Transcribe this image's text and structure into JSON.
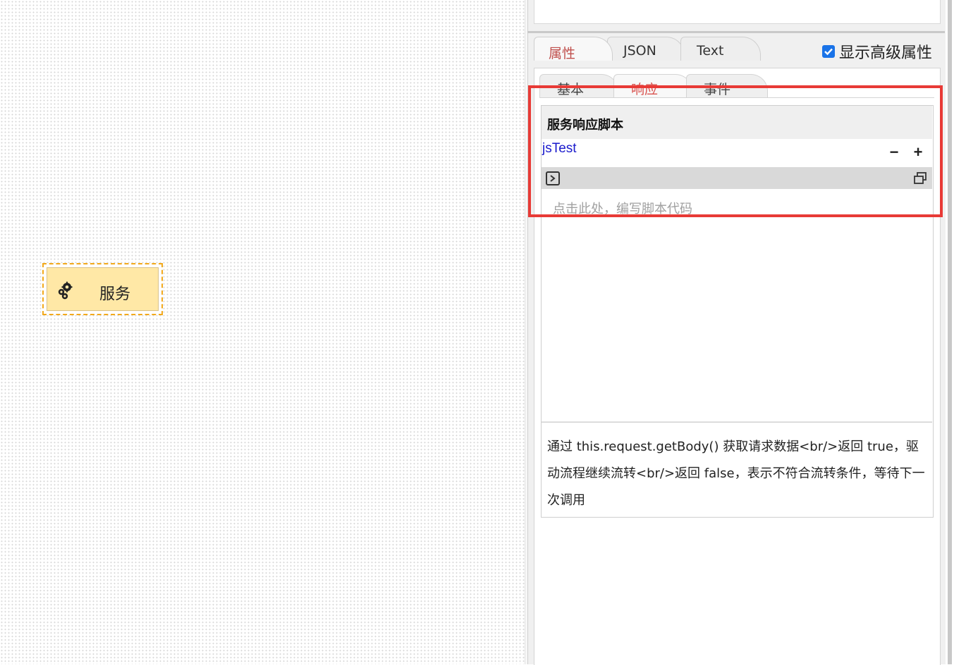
{
  "canvas": {
    "node": {
      "label": "服务",
      "icon": "gears-icon"
    }
  },
  "panel": {
    "tabs": [
      {
        "label": "属性",
        "active": true
      },
      {
        "label": "JSON",
        "active": false
      },
      {
        "label": "Text",
        "active": false
      }
    ],
    "show_advanced": {
      "label": "显示高级属性",
      "checked": true
    },
    "subtabs": [
      {
        "label": "基本",
        "active": false
      },
      {
        "label": "响应",
        "active": true
      },
      {
        "label": "事件",
        "active": false
      }
    ],
    "script": {
      "title": "服务响应脚本",
      "name": "jsTest",
      "remove_label": "−",
      "add_label": "+",
      "placeholder": "点击此处，编写脚本代码",
      "description": "通过 this.request.getBody() 获取请求数据<br/>返回 true，驱动流程继续流转<br/>返回 false，表示不符合流转条件，等待下一次调用"
    }
  },
  "colors": {
    "active_tab": "#c0504d",
    "highlight": "#e83a36",
    "node_fill": "#ffe8a6",
    "node_border": "#f2a91c",
    "script_name": "#1a1acc"
  }
}
